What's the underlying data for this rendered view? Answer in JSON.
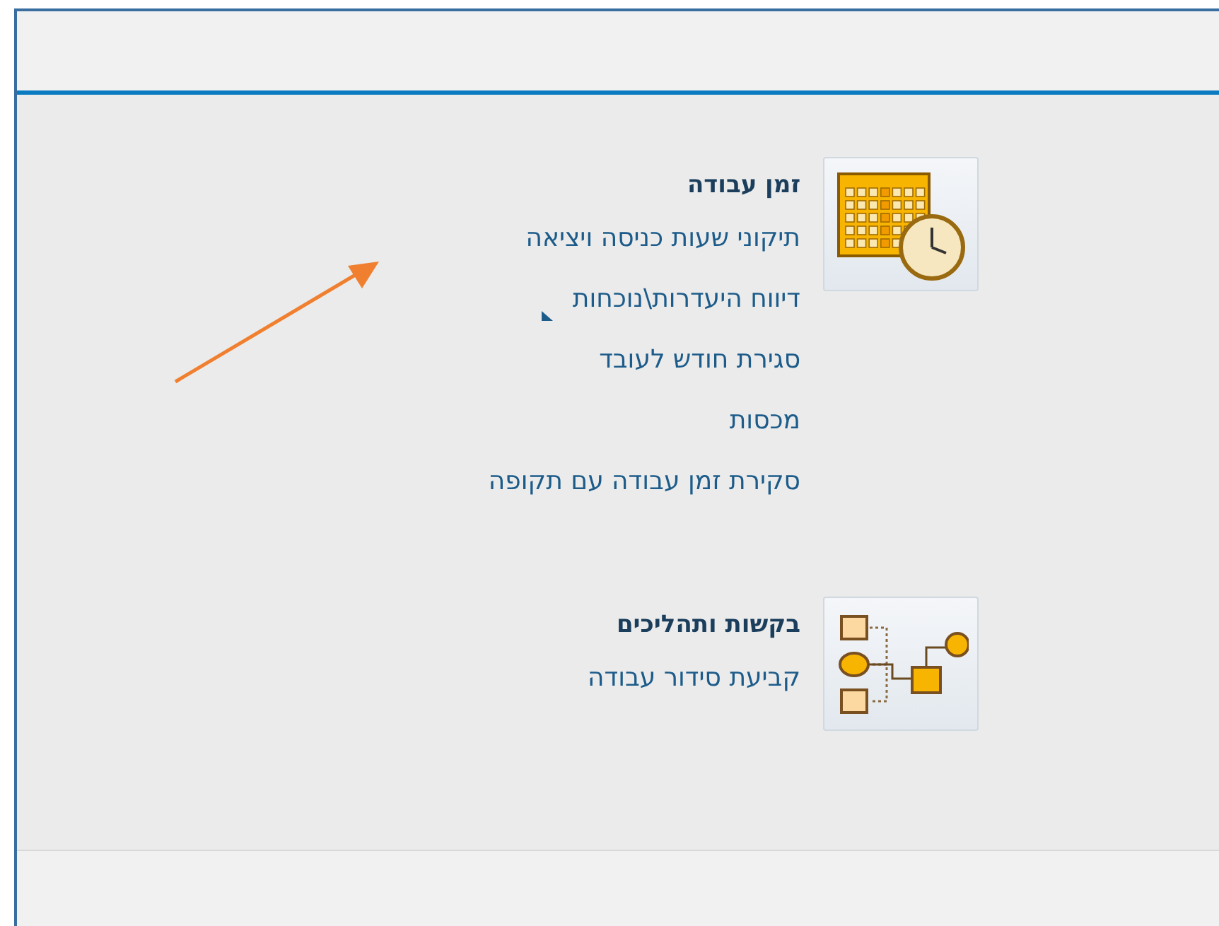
{
  "sections": [
    {
      "kind": "calendar",
      "title": "זמן עבודה",
      "links": [
        {
          "label": "תיקוני שעות כניסה ויציאה",
          "marker": false
        },
        {
          "label": "דיווח היעדרות\\נוכחות",
          "marker": true
        },
        {
          "label": "סגירת חודש לעובד",
          "marker": false
        },
        {
          "label": "מכסות",
          "marker": false
        },
        {
          "label": "סקירת זמן עבודה עם תקופה",
          "marker": false
        }
      ]
    },
    {
      "kind": "process",
      "title": "בקשות ותהליכים",
      "links": [
        {
          "label": "קביעת סידור עבודה",
          "marker": false
        }
      ]
    }
  ]
}
